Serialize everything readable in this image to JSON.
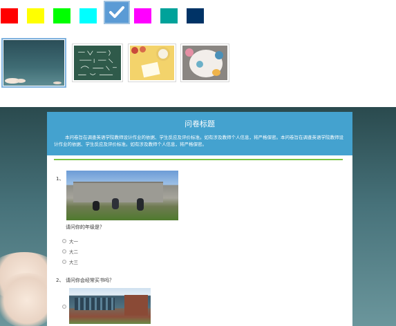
{
  "palette": {
    "colors": [
      "#ff0000",
      "#ffff00",
      "#00ff00",
      "#00ffff",
      "#5b9bd5",
      "#ff00ff",
      "#00a29a",
      "#003366"
    ],
    "selected_index": 4,
    "check_icon": "checkmark-icon"
  },
  "themes": {
    "items": [
      "sky-theme",
      "chalkboard-theme",
      "yellow-desk-theme",
      "table-top-theme"
    ],
    "selected_index": 0
  },
  "survey": {
    "title": "问卷标题",
    "description": "本问卷旨在调查英语学院教师设计作业的依据、学生反应及评价标准。如有涉及教师个人信息，将严格保密。本问卷旨在调查英语学院教师设计作业的依据、学生反应及评价标准。如有涉及教师个人信息，将严格保密。",
    "questions": [
      {
        "number": "1、",
        "text": "请问你的年级是？",
        "options": [
          "大一",
          "大二",
          "大三"
        ]
      },
      {
        "number": "2、",
        "text": "请问你会经常买书吗？",
        "options": [
          ""
        ]
      }
    ]
  }
}
